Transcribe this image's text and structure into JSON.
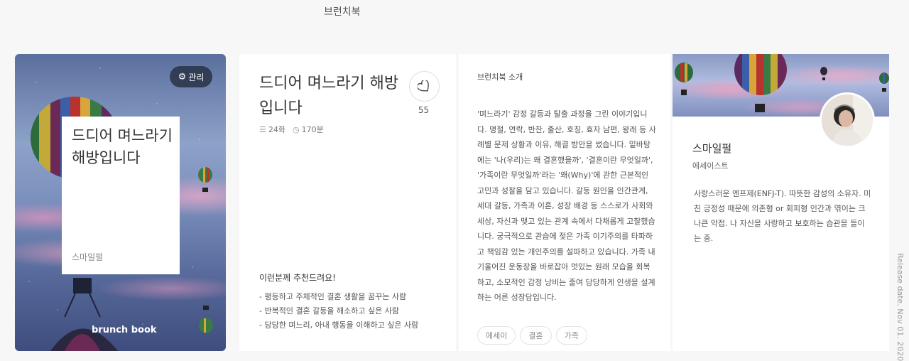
{
  "page": {
    "top_title": "브런치북"
  },
  "cover": {
    "manage_label": "관리",
    "title": "드디어 며느라기 해방입니다",
    "author": "스마일펄",
    "brand": "brunch book"
  },
  "book": {
    "title": "드디어 며느라기 해방입니다",
    "episodes": "24화",
    "duration": "170분",
    "likes": "55",
    "recommend_title": "이런분께 추천드려요!",
    "recommend": [
      "- 평등하고 주체적인 결혼 생활을 꿈꾸는 사람",
      "- 반복적인 결혼 갈등을 해소하고 싶은 사람",
      "- 당당한 며느리, 아내 행동을 이해하고 싶은 사람"
    ]
  },
  "intro": {
    "heading": "브런치북 소개",
    "text": "'며느라기' 감정 갈등과 탈출 과정을 그린 이야기입니다. 명절, 연락, 반찬, 출산, 호칭, 효자 남편, 왕래 등 사례별 문제 상황과 이유, 해결 방안을 썼습니다. 밑바탕에는 '나(우리)는 왜 결혼했을까', '결혼이란 무엇일까', '가족이란 무엇일까'라는 '왜(Why)'에 관한 근본적인 고민과 성찰을 담고 있습니다. 갈등 원인을 인간관계, 세대 갈등, 가족과 이혼, 성장 배경 등 스스로가 사회와 세상, 자신과 맺고 있는 관계 속에서 다채롭게 고찰했습니다. 궁극적으로 관습에 젖은 가족 이기주의를 타파하고 책임감 있는 개인주의를 설파하고 있습니다. 가족 내 기울어진 운동장을 바로잡아 멋있는 원래 모습을 회복하고, 소모적인 감정 낭비는 줄여 당당하게 인생을 설계하는 어른 성장담입니다.",
    "tags": [
      "에세이",
      "결혼",
      "가족"
    ]
  },
  "author": {
    "name": "스마일펄",
    "role": "에세이스트",
    "bio": "사랑스러운 엔프제(ENFJ-T). 따뜻한 감성의 소유자. 미친 긍정성 때문에 의존형 or 회피형 인간과 엮이는 크나큰 악접. 나 자신을 사랑하고 보호하는 습관을 들이는 중."
  },
  "release_date": "Release date. Nov 01. 2020",
  "icons": {
    "manage": "gear-icon",
    "like": "heart-icon",
    "episodes": "list-icon",
    "duration": "clock-icon"
  }
}
